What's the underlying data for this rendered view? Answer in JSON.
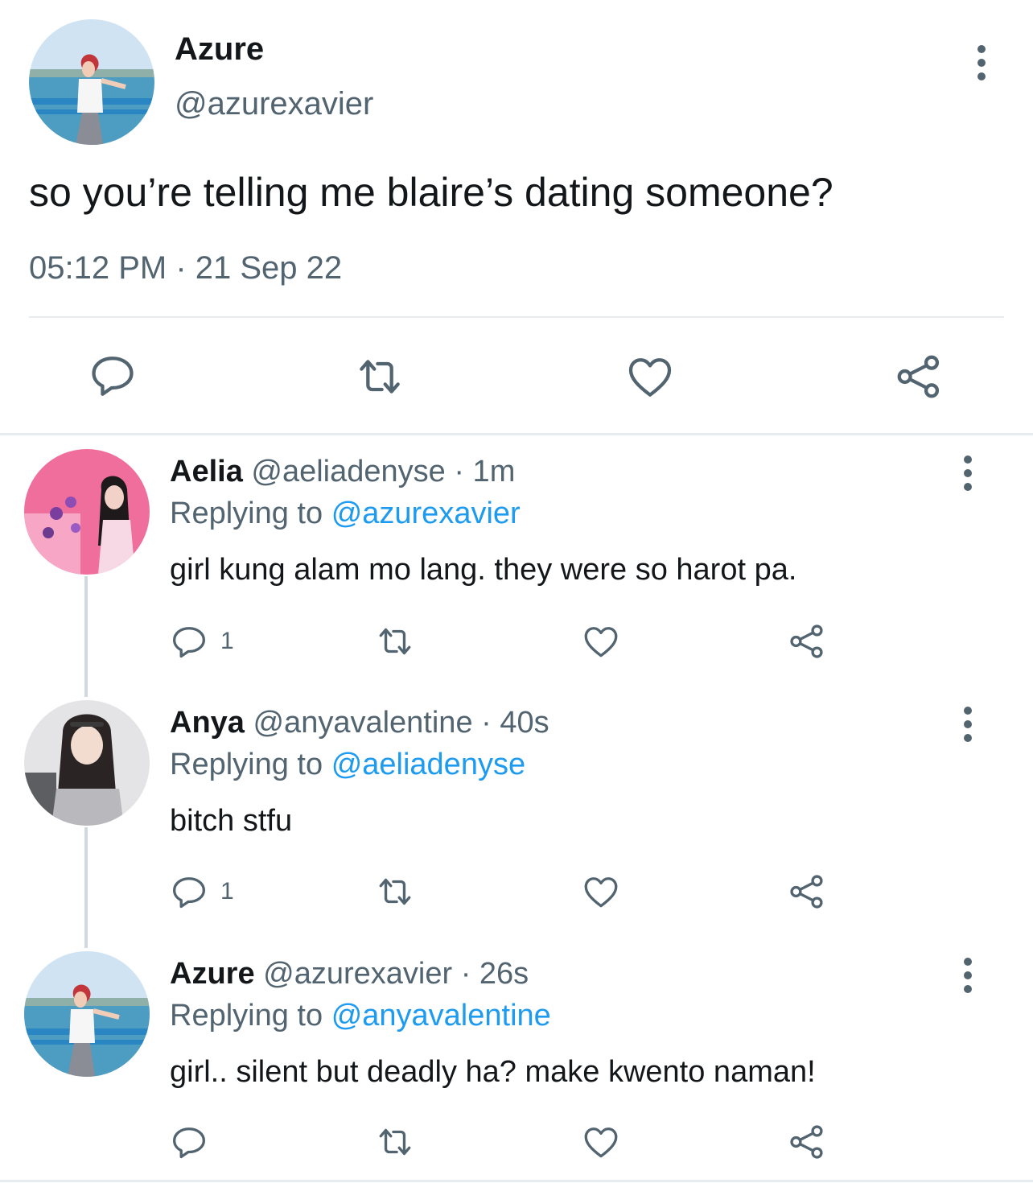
{
  "tweet": {
    "name": "Azure",
    "handle": "@azurexavier",
    "text": "so you’re telling me blaire’s dating someone?",
    "timestamp": "05:12 PM · 21 Sep 22"
  },
  "replies": [
    {
      "name": "Aelia",
      "meta": "@aeliadenyse · 1m",
      "replying_prefix": "Replying to",
      "replying_handle": "@azurexavier",
      "text": "girl kung alam mo lang. they were so harot pa.",
      "reply_count": "1"
    },
    {
      "name": "Anya",
      "meta": "@anyavalentine · 40s",
      "replying_prefix": "Replying to",
      "replying_handle": "@aeliadenyse",
      "text": "bitch stfu",
      "reply_count": "1"
    },
    {
      "name": "Azure",
      "meta": "@azurexavier · 26s",
      "replying_prefix": "Replying to",
      "replying_handle": "@anyavalentine",
      "text": "girl.. silent but deadly ha? make kwento naman!",
      "reply_count": ""
    }
  ],
  "icons": {
    "reply": "reply-icon",
    "retweet": "retweet-icon",
    "like": "heart-icon",
    "share": "share-icon",
    "more": "more-options-icon"
  },
  "colors": {
    "text": "#14171a",
    "secondary": "#536471",
    "link": "#1d9bf0",
    "divider": "#e6ecf0"
  }
}
